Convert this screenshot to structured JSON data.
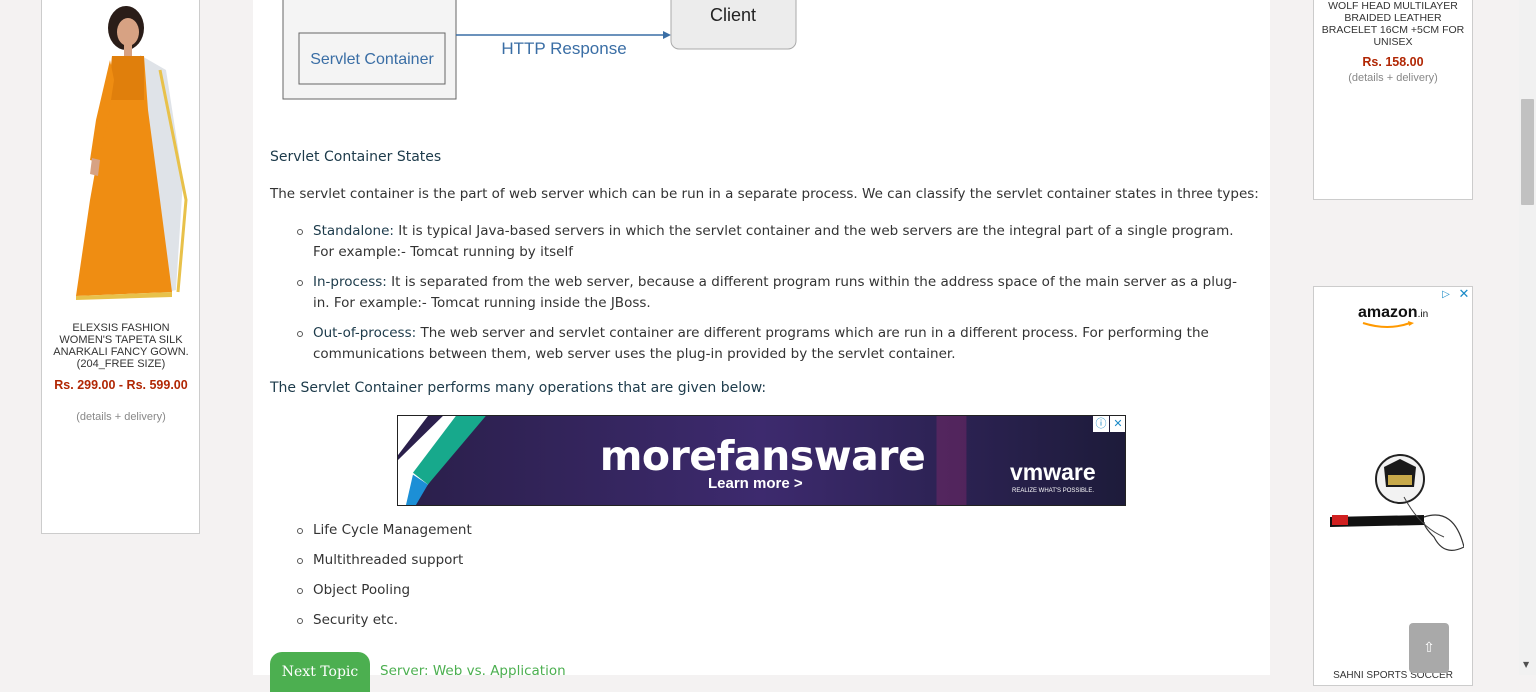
{
  "left_ad": {
    "product_title": "ELEXSIS FASHION WOMEN'S TAPETA SILK ANARKALI FANCY GOWN. (204_FREE SIZE)",
    "price": "Rs. 299.00 - Rs. 599.00",
    "details": "(details + delivery)"
  },
  "diagram": {
    "container_label": "Servlet Container",
    "response_label": "HTTP Response",
    "client_label": "Client"
  },
  "article": {
    "states_heading": "Servlet Container States",
    "states_intro": "The servlet container is the part of web server which can be run in a separate process. We can classify the servlet container states in three types:",
    "states": [
      {
        "term": "Standalone:",
        "text": "It is typical Java-based servers in which the servlet container and the web servers are the integral part of a single program. For example:- Tomcat running by itself"
      },
      {
        "term": "In-process:",
        "text": "It is separated from the web server, because a different program runs within the address space of the main server as a plug-in. For example:- Tomcat running inside the JBoss."
      },
      {
        "term": "Out-of-process:",
        "text": "The web server and servlet container are different programs which are run in a different process. For performing the communications between them, web server uses the plug-in provided by the servlet container."
      }
    ],
    "operations_heading": "The Servlet Container performs many operations that are given below:",
    "operations": [
      "Life Cycle Management",
      "Multithreaded support",
      "Object Pooling",
      "Security etc."
    ],
    "next_button": "Next Topic",
    "next_link": "Server: Web vs. Application"
  },
  "banner": {
    "brand": "morefansware",
    "cta": "Learn more >",
    "advertiser": "vmware",
    "advertiser_tagline": "REALIZE WHAT'S POSSIBLE."
  },
  "right_ad_top": {
    "product_title": "WOLF HEAD MULTILAYER BRAIDED LEATHER BRACELET 16CM +5CM FOR UNISEX",
    "price": "Rs. 158.00",
    "details": "(details + delivery)"
  },
  "right_ad_bottom": {
    "logo": "amazon",
    "logo_suffix": ".in",
    "product_title": "SAHNI SPORTS SOCCER"
  },
  "scroll_top": "⇧",
  "colors": {
    "accent_green": "#4caf50",
    "price_red": "#b12704",
    "heading": "#1c3a4a"
  }
}
